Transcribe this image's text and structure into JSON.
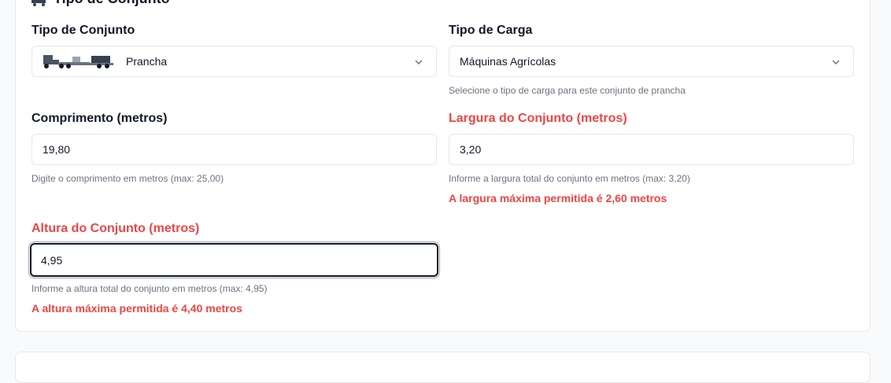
{
  "section": {
    "title": "Tipo de Conjunto"
  },
  "tipo_conjunto": {
    "label": "Tipo de Conjunto",
    "value": "Prancha",
    "icon": "truck-lowboy-icon"
  },
  "tipo_carga": {
    "label": "Tipo de Carga",
    "value": "Máquinas Agrícolas",
    "hint": "Selecione o tipo de carga para este conjunto de prancha"
  },
  "comprimento": {
    "label": "Comprimento (metros)",
    "value": "19,80",
    "hint": "Digite o comprimento em metros (max: 25,00)"
  },
  "largura": {
    "label": "Largura do Conjunto (metros)",
    "value": "3,20",
    "hint": "Informe a largura total do conjunto em metros (max: 3,20)",
    "error": "A largura máxima permitida é 2,60 metros"
  },
  "altura": {
    "label": "Altura do Conjunto (metros)",
    "value": "4,95",
    "hint": "Informe a altura total do conjunto em metros (max: 4,95)",
    "error": "A altura máxima permitida é 4,40 metros"
  },
  "colors": {
    "error": "#ef4444",
    "text": "#111827",
    "muted": "#6b7280",
    "border": "#e5e7eb"
  }
}
